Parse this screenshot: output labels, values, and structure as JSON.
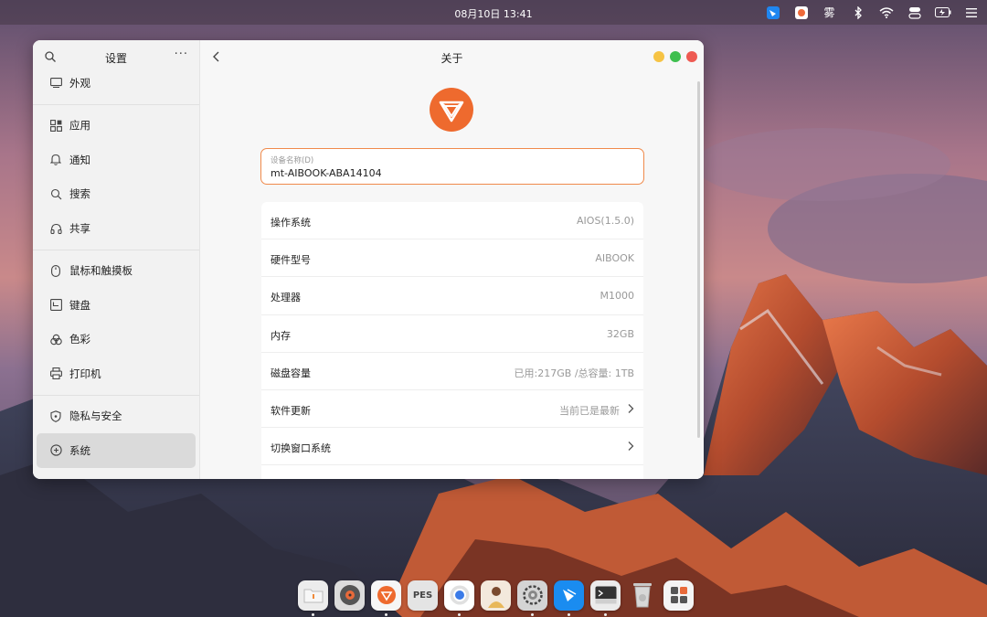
{
  "topbar": {
    "clock": "08月10日 13:41",
    "tray_icons": [
      "feishu-icon",
      "app-icon",
      "weather-icon",
      "bluetooth-icon",
      "wifi-icon",
      "control-center-icon",
      "battery-icon",
      "menu-icon"
    ],
    "weather_glyph": "雾"
  },
  "sidebar": {
    "title": "设置",
    "groups": [
      [
        {
          "label": "外观",
          "icon": "appearance-icon"
        }
      ],
      [
        {
          "label": "应用",
          "icon": "apps-icon"
        },
        {
          "label": "通知",
          "icon": "bell-icon"
        },
        {
          "label": "搜索",
          "icon": "search-icon"
        },
        {
          "label": "共享",
          "icon": "share-icon"
        }
      ],
      [
        {
          "label": "鼠标和触摸板",
          "icon": "mouse-icon"
        },
        {
          "label": "键盘",
          "icon": "keyboard-icon"
        },
        {
          "label": "色彩",
          "icon": "palette-icon"
        },
        {
          "label": "打印机",
          "icon": "printer-icon"
        }
      ],
      [
        {
          "label": "隐私与安全",
          "icon": "shield-icon"
        },
        {
          "label": "系统",
          "icon": "system-icon"
        }
      ]
    ]
  },
  "main": {
    "title": "关于",
    "device_name_label": "设备名称(D)",
    "device_name_value": "mt-AIBOOK-ABA14104",
    "rows": [
      {
        "key": "操作系统",
        "value": "AIOS(1.5.0)",
        "chevron": false
      },
      {
        "key": "硬件型号",
        "value": "AIBOOK",
        "chevron": false
      },
      {
        "key": "处理器",
        "value": "M1000",
        "chevron": false
      },
      {
        "key": "内存",
        "value": "32GB",
        "chevron": false
      },
      {
        "key": "磁盘容量",
        "value": "已用:217GB /总容量: 1TB",
        "chevron": false
      },
      {
        "key": "软件更新",
        "value": "当前已是最新",
        "chevron": true
      },
      {
        "key": "切换窗口系统",
        "value": "",
        "chevron": true
      }
    ]
  },
  "dock": {
    "items": [
      {
        "name": "files",
        "label": "",
        "color": "#e9e9e9",
        "running": true
      },
      {
        "name": "music",
        "label": "",
        "color": "#d8d8d8",
        "running": false
      },
      {
        "name": "browser",
        "label": "",
        "color": "#f5f5f5",
        "running": true
      },
      {
        "name": "pes",
        "label": "PES",
        "color": "#e2e2e2",
        "running": false
      },
      {
        "name": "chrome",
        "label": "",
        "color": "#ffffff",
        "running": true
      },
      {
        "name": "photo",
        "label": "",
        "color": "#f0e8d8",
        "running": false
      },
      {
        "name": "settings",
        "label": "",
        "color": "#d0d0d0",
        "running": true
      },
      {
        "name": "feishu",
        "label": "",
        "color": "#1a8cf0",
        "running": true
      },
      {
        "name": "terminal",
        "label": "",
        "color": "#e6e6e6",
        "running": true
      },
      {
        "name": "trash",
        "label": "",
        "color": "#bcbcbc",
        "running": false
      },
      {
        "name": "launcher",
        "label": "",
        "color": "#f2f2f2",
        "running": false
      }
    ]
  }
}
